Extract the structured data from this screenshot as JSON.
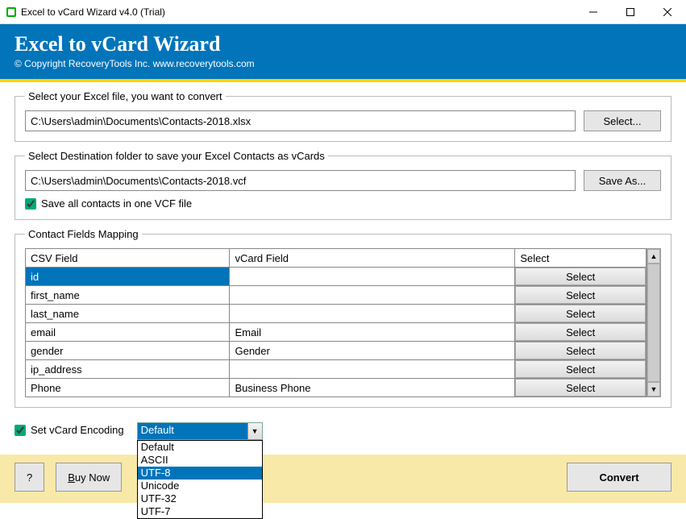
{
  "window": {
    "title": "Excel to vCard Wizard v4.0 (Trial)"
  },
  "banner": {
    "title": "Excel to vCard Wizard",
    "copyright": "© Copyright RecoveryTools Inc. www.recoverytools.com"
  },
  "source": {
    "legend": "Select your Excel file, you want to convert",
    "path": "C:\\Users\\admin\\Documents\\Contacts-2018.xlsx",
    "button": "Select..."
  },
  "dest": {
    "legend": "Select Destination folder to save your Excel Contacts as vCards",
    "path": "C:\\Users\\admin\\Documents\\Contacts-2018.vcf",
    "button": "Save As...",
    "checkbox": "Save all contacts in one VCF file",
    "checked": true
  },
  "mapping": {
    "legend": "Contact Fields Mapping",
    "headers": [
      "CSV Field",
      "vCard Field",
      "Select"
    ],
    "select_label": "Select",
    "rows": [
      {
        "csv": "id",
        "vcard": "",
        "selected": true
      },
      {
        "csv": "first_name",
        "vcard": ""
      },
      {
        "csv": "last_name",
        "vcard": ""
      },
      {
        "csv": "email",
        "vcard": "Email"
      },
      {
        "csv": "gender",
        "vcard": "Gender"
      },
      {
        "csv": "ip_address",
        "vcard": ""
      },
      {
        "csv": "Phone",
        "vcard": "Business Phone"
      }
    ]
  },
  "encoding": {
    "label": "Set vCard Encoding",
    "checked": true,
    "selected": "Default",
    "highlighted": "UTF-8",
    "options": [
      "Default",
      "ASCII",
      "UTF-8",
      "Unicode",
      "UTF-32",
      "UTF-7"
    ]
  },
  "footer": {
    "help": "?",
    "buy_prefix": "B",
    "buy_rest": "uy Now",
    "convert": "Convert"
  }
}
